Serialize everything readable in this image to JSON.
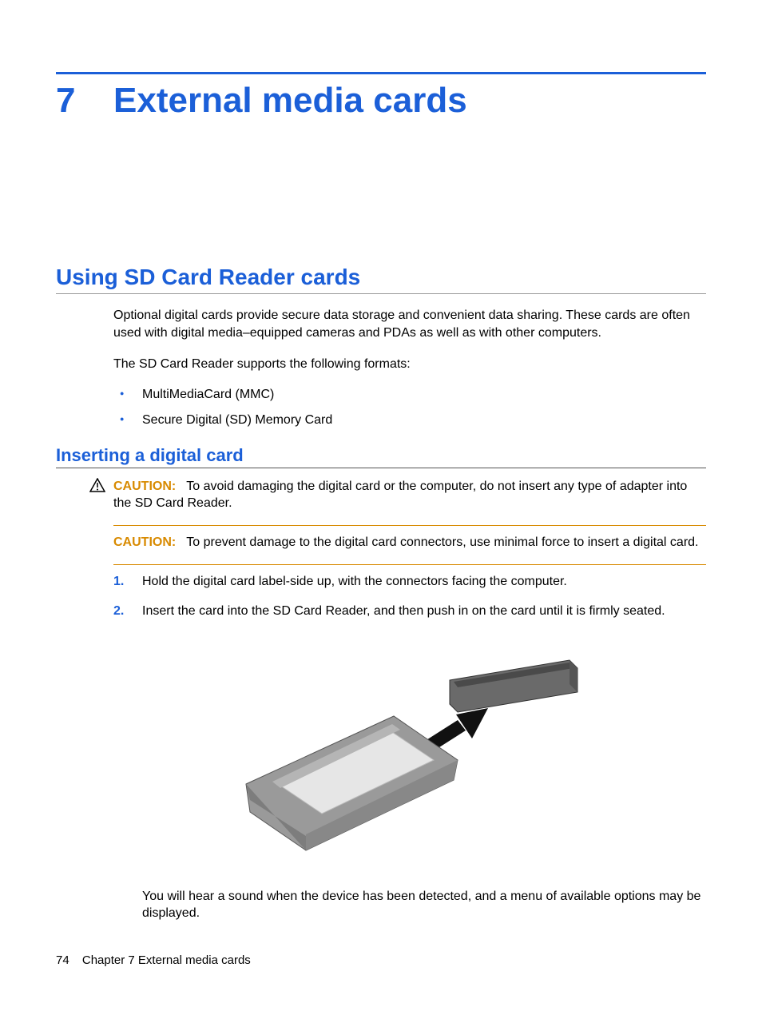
{
  "chapter": {
    "number": "7",
    "title": "External media cards"
  },
  "section1": {
    "title": "Using SD Card Reader cards",
    "intro": "Optional digital cards provide secure data storage and convenient data sharing. These cards are often used with digital media–equipped cameras and PDAs as well as with other computers.",
    "supportsLine": "The SD Card Reader supports the following formats:",
    "formats": [
      "MultiMediaCard (MMC)",
      "Secure Digital (SD) Memory Card"
    ]
  },
  "subsection1": {
    "title": "Inserting a digital card",
    "cautionLabel": "CAUTION:",
    "caution1": "To avoid damaging the digital card or the computer, do not insert any type of adapter into the SD Card Reader.",
    "caution2": "To prevent damage to the digital card connectors, use minimal force to insert a digital card.",
    "steps": [
      {
        "num": "1.",
        "text": "Hold the digital card label-side up, with the connectors facing the computer."
      },
      {
        "num": "2.",
        "text": "Insert the card into the SD Card Reader, and then push in on the card until it is firmly seated."
      }
    ],
    "note": "You will hear a sound when the device has been detected, and a menu of available options may be displayed."
  },
  "footer": {
    "pageNum": "74",
    "chapterLabel": "Chapter 7   External media cards"
  }
}
